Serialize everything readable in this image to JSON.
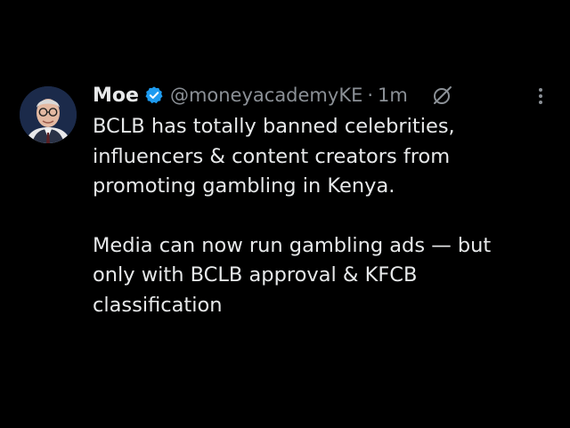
{
  "tweet": {
    "author": {
      "name": "Moe",
      "handle": "@moneyacademyKE",
      "verified": true
    },
    "separator": "·",
    "timestamp": "1m",
    "paragraphs": [
      [
        "BCLB has totally banned celebrities,",
        "influencers & content creators from",
        "promoting gambling in Kenya."
      ],
      [
        "Media can now run gambling ads — but",
        "only with BCLB approval & KFCB",
        "classification"
      ]
    ]
  },
  "icons": {
    "verified": "verified-badge-icon",
    "grok": "grok-icon",
    "more": "more-options-icon"
  },
  "colors": {
    "background": "#000000",
    "text": "#e7e9ea",
    "secondary": "#8b9096",
    "verified": "#1d9bf0"
  }
}
